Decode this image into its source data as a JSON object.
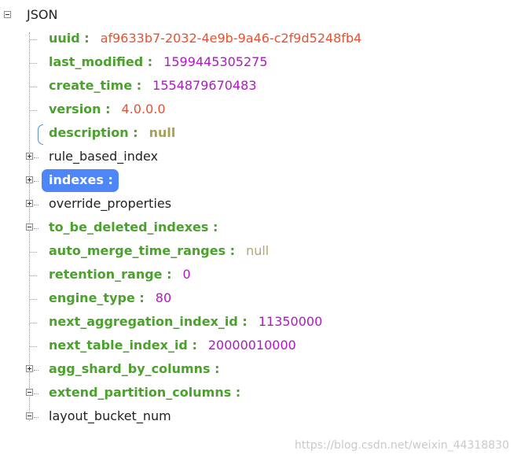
{
  "root": {
    "label": "JSON"
  },
  "nodes": [
    {
      "key": "uuid :",
      "value": "af9633b7-2032-4e9b-9a46-c2f9d5248fb4"
    },
    {
      "key": "last_modified :",
      "value": "1599445305275"
    },
    {
      "key": "create_time :",
      "value": "1554879670483"
    },
    {
      "key": "version :",
      "value": "4.0.0.0"
    },
    {
      "key": "description :",
      "value": "null"
    },
    {
      "key": "rule_based_index"
    },
    {
      "key": "indexes :"
    },
    {
      "key": "override_properties"
    },
    {
      "key": "to_be_deleted_indexes :"
    },
    {
      "key": "auto_merge_time_ranges :",
      "value": "null"
    },
    {
      "key": "retention_range :",
      "value": "0"
    },
    {
      "key": "engine_type :",
      "value": "80"
    },
    {
      "key": "next_aggregation_index_id :",
      "value": "11350000"
    },
    {
      "key": "next_table_index_id :",
      "value": "20000010000"
    },
    {
      "key": "agg_shard_by_columns :"
    },
    {
      "key": "extend_partition_columns :"
    },
    {
      "key": "layout_bucket_num"
    }
  ],
  "watermark": "https://blog.csdn.net/weixin_44318830"
}
